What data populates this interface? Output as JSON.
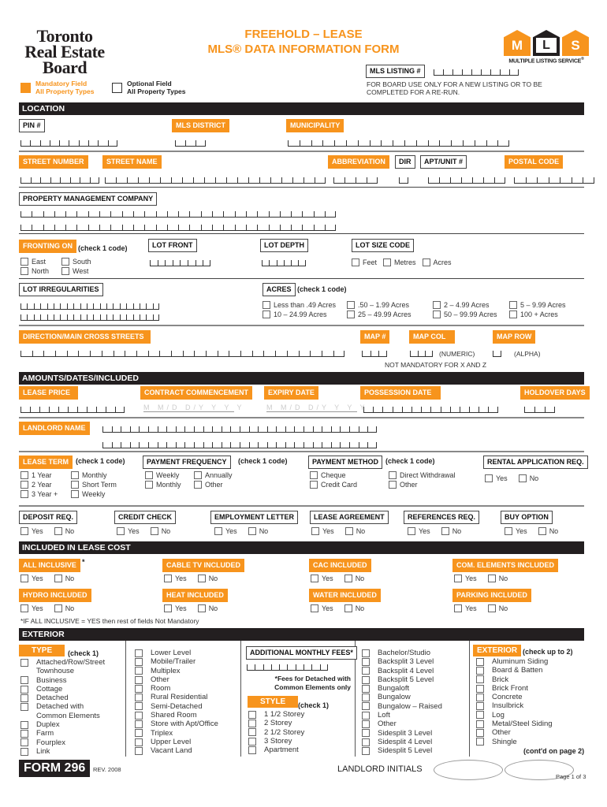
{
  "header": {
    "board_name_lines": [
      "Toronto",
      "Real Estate",
      "Board"
    ],
    "title_line1": "FREEHOLD – LEASE",
    "title_line2": "MLS® DATA INFORMATION FORM",
    "mls_logo": {
      "letters": [
        "M",
        "L",
        "S"
      ],
      "caption": "MULTIPLE LISTING SERVICE",
      "mark": "®"
    },
    "legend_mandatory": [
      "Mandatory Field",
      "All Property Types"
    ],
    "legend_optional": [
      "Optional Field",
      "All Property Types"
    ],
    "mls_listing_label": "MLS LISTING #",
    "board_use_note": [
      "FOR BOARD USE ONLY FOR A NEW LISTING OR TO BE",
      "COMPLETED FOR A RE-RUN."
    ],
    "colors": {
      "orange": "#f7941d",
      "black": "#231f20"
    }
  },
  "location": {
    "section_title": "LOCATION",
    "pin": "PIN #",
    "mls_district": "MLS DISTRICT",
    "municipality": "MUNICIPALITY",
    "street_number": "STREET NUMBER",
    "street_name": "STREET NAME",
    "abbreviation": "ABBREVIATION",
    "dir": "DIR",
    "apt_unit": "APT/UNIT #",
    "postal_code": "POSTAL CODE",
    "property_mgmt": "PROPERTY MANAGEMENT COMPANY",
    "fronting_on": "FRONTING ON",
    "check1": "(check 1 code)",
    "fronting_options": [
      "East",
      "South",
      "North",
      "West"
    ],
    "lot_front": "LOT FRONT",
    "lot_depth": "LOT DEPTH",
    "lot_size_code": "LOT SIZE CODE",
    "lot_size_options": [
      "Feet",
      "Metres",
      "Acres"
    ],
    "lot_irregularities": "LOT IRREGULARITIES",
    "acres": "ACRES",
    "acres_options": [
      "Less than .49 Acres",
      ".50 – 1.99 Acres",
      "2 – 4.99 Acres",
      "5 – 9.99 Acres",
      "10 – 24.99 Acres",
      "25 – 49.99 Acres",
      "50 – 99.99 Acres",
      "100 + Acres"
    ],
    "direction": "DIRECTION/MAIN CROSS STREETS",
    "map_num": "MAP #",
    "map_col": "MAP COL",
    "map_row": "MAP ROW",
    "numeric": "(NUMERIC)",
    "alpha": "(ALPHA)",
    "not_mandatory": "NOT MANDATORY FOR X AND Z"
  },
  "amounts": {
    "section_title": "AMOUNTS/DATES/INCLUDED",
    "lease_price": "LEASE PRICE",
    "contract_commencement": "CONTRACT COMMENCEMENT",
    "expiry_date": "EXPIRY DATE",
    "possession_date": "POSSESSION DATE",
    "holdover_days": "HOLDOVER DAYS",
    "date_placeholder": "M M/D D/Y Y Y Y",
    "landlord_name": "LANDLORD NAME",
    "lease_term": "LEASE TERM",
    "check1": "(check 1 code)",
    "lease_term_options": [
      "1 Year",
      "Monthly",
      "2 Year",
      "Short Term",
      "3 Year +",
      "Weekly"
    ],
    "payment_frequency": "PAYMENT FREQUENCY",
    "payment_frequency_options": [
      "Weekly",
      "Annually",
      "Monthly",
      "Other"
    ],
    "payment_method": "PAYMENT METHOD",
    "payment_method_options": [
      "Cheque",
      "Direct Withdrawal",
      "Credit Card",
      "Other"
    ],
    "rental_application": "RENTAL APPLICATION REQ.",
    "yes": "Yes",
    "no": "No",
    "deposit": "DEPOSIT REQ.",
    "credit_check": "CREDIT CHECK",
    "employment_letter": "EMPLOYMENT LETTER",
    "lease_agreement": "LEASE AGREEMENT",
    "references": "REFERENCES REQ.",
    "buy_option": "BUY OPTION"
  },
  "included": {
    "section_title": "INCLUDED IN LEASE COST",
    "items": [
      "ALL INCLUSIVE",
      "CABLE TV INCLUDED",
      "CAC INCLUDED",
      "COM. ELEMENTS INCLUDED",
      "HYDRO INCLUDED",
      "HEAT INCLUDED",
      "WATER INCLUDED",
      "PARKING INCLUDED"
    ],
    "asterisk": "*",
    "footnote": "*IF ALL INCLUSIVE = YES then rest of fields Not Mandatory"
  },
  "exterior": {
    "section_title": "EXTERIOR",
    "type": "TYPE",
    "check1": "(check 1)",
    "type_col1": [
      "Attached/Row/Street",
      "Townhouse",
      "Business",
      "Cottage",
      "Detached",
      "Detached with",
      "Common Elements",
      "Duplex",
      "Farm",
      "Fourplex",
      "Link"
    ],
    "type_col2": [
      "Lower Level",
      "Mobile/Trailer",
      "Multiplex",
      "Other",
      "Room",
      "Rural Residential",
      "Semi-Detached",
      "Shared Room",
      "Store with Apt/Office",
      "Triplex",
      "Upper Level",
      "Vacant Land"
    ],
    "additional_fees": "ADDITIONAL MONTHLY  FEES*",
    "fees_note": [
      "*Fees for Detached with",
      "Common Elements only"
    ],
    "style": "STYLE",
    "style_col1": [
      "1 1/2 Storey",
      "2 Storey",
      "2 1/2 Storey",
      "3 Storey",
      "Apartment"
    ],
    "style_col2": [
      "Bachelor/Studio",
      "Backsplit 3 Level",
      "Backsplit 4 Level",
      "Backsplit 5 Level",
      "Bungaloft",
      "Bungalow",
      "Bungalow – Raised",
      "Loft",
      "Other",
      "Sidesplit 3 Level",
      "Sidesplit 4 Level",
      "Sidesplit 5 Level"
    ],
    "exterior": "EXTERIOR",
    "check_up_to_2": "(check up to 2)",
    "exterior_options": [
      "Aluminum Siding",
      "Board & Batten",
      "Brick",
      "Brick Front",
      "Concrete",
      "Insulbrick",
      "Log",
      "Metal/Steel Siding",
      "Other",
      "Shingle"
    ],
    "contd": "(cont'd on page 2)"
  },
  "footer": {
    "form": "FORM 296",
    "rev": "REV. 2008",
    "landlord_initials": "LANDLORD INITIALS",
    "page": "Page 1 of 3"
  }
}
